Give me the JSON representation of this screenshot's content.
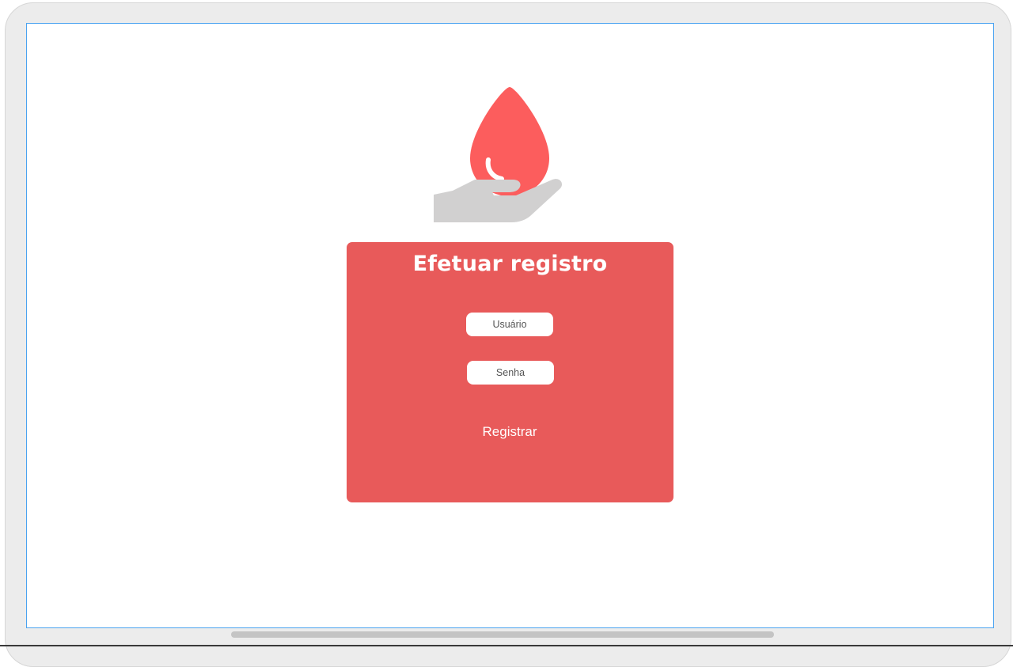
{
  "form": {
    "title": "Efetuar registro",
    "username_placeholder": "Usuário",
    "password_placeholder": "Senha",
    "submit_label": "Registrar"
  },
  "logo": {
    "icon": "blood-drop-in-hand-icon",
    "drop_color": "#fc5d5d",
    "hand_color": "#d1d0d0"
  },
  "colors": {
    "card_background": "#e85a5a",
    "field_background": "#ffffff",
    "title_text": "#ffffff"
  }
}
